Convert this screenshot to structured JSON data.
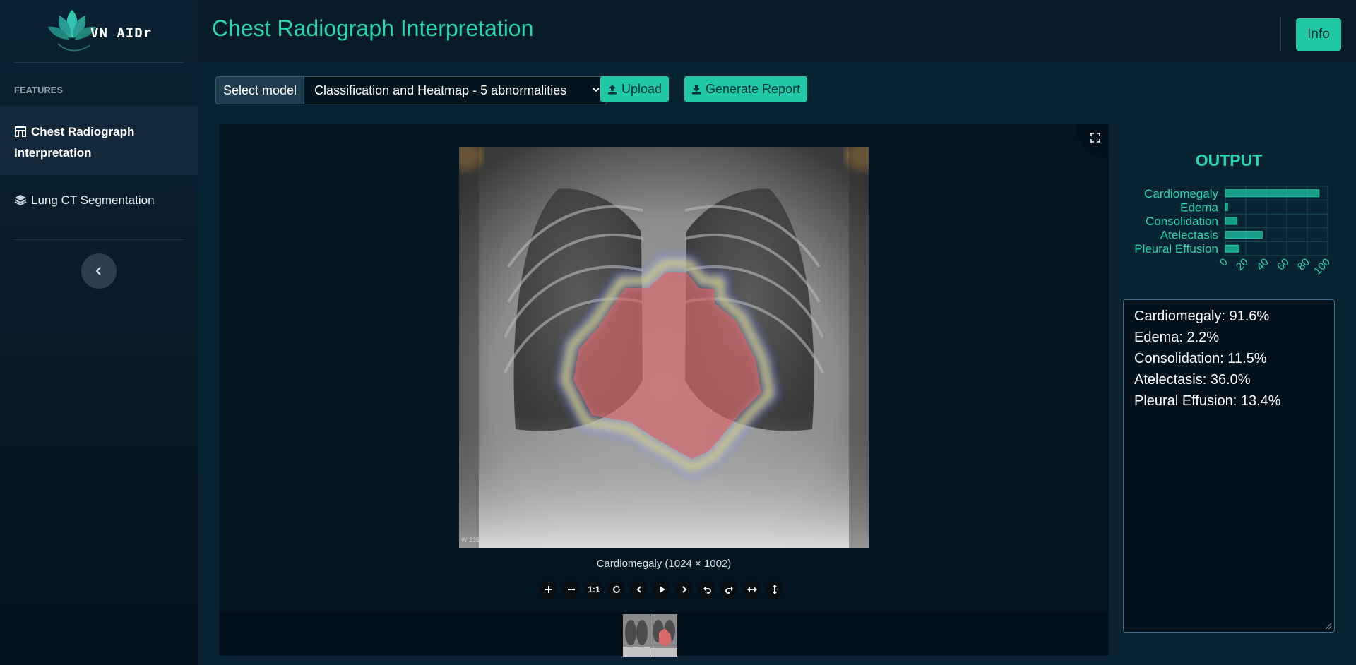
{
  "app": {
    "name": "VN AIDr"
  },
  "sidebar": {
    "heading": "FEATURES",
    "items": [
      {
        "label": "Chest Radiograph Interpretation",
        "active": true,
        "icon": "hospital-icon"
      },
      {
        "label": "Lung CT Segmentation",
        "active": false,
        "icon": "layers-icon"
      }
    ],
    "collapse_icon": "chevron-left-icon"
  },
  "header": {
    "title": "Chest Radiograph Interpretation",
    "info_label": "Info"
  },
  "toolbar": {
    "select_label": "Select model",
    "selected_model": "Classification and Heatmap - 5 abnormalities",
    "upload_label": "Upload",
    "report_label": "Generate Report"
  },
  "viewer": {
    "caption": "Cardiomegaly (1024 × 1002)",
    "image_overlay_text": "W 2351 : L 2945",
    "controls": [
      "zoom-in",
      "zoom-out",
      "1:1",
      "reset",
      "previous",
      "play",
      "next",
      "rotate-left",
      "rotate-right",
      "flip-horizontal",
      "flip-vertical"
    ],
    "one_to_one_label": "1:1",
    "thumbnail_count": 2
  },
  "output": {
    "title": "OUTPUT",
    "results": [
      "Cardiomegaly: 91.6%",
      "Edema: 2.2%",
      "Consolidation: 11.5%",
      "Atelectasis: 36.0%",
      "Pleural Effusion: 13.4%"
    ]
  },
  "chart_data": {
    "type": "bar",
    "orientation": "horizontal",
    "categories": [
      "Cardiomegaly",
      "Edema",
      "Consolidation",
      "Atelectasis",
      "Pleural Effusion"
    ],
    "values": [
      91.6,
      2.2,
      11.5,
      36.0,
      13.4
    ],
    "xlim": [
      0,
      100
    ],
    "xticks": [
      "0",
      "20",
      "40",
      "60",
      "80",
      "100"
    ],
    "grid": true,
    "color": "#1fc9a5"
  },
  "colors": {
    "accent": "#26d6b6",
    "button": "#1fc9a5",
    "background": "#082334"
  }
}
